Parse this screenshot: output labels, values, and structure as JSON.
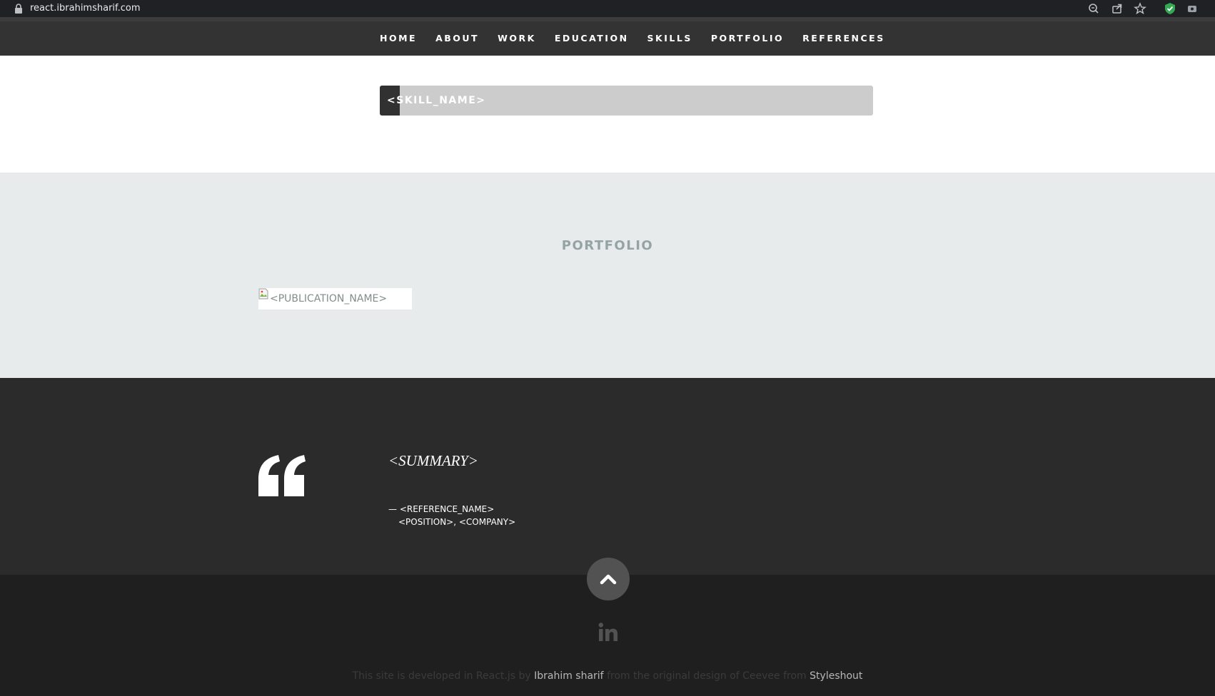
{
  "browser": {
    "url": "react.ibrahimsharif.com",
    "icons": [
      "lock-icon",
      "zoom-icon",
      "share-icon",
      "bookmark-star-icon",
      "shield-extension-icon",
      "extension-icon"
    ]
  },
  "nav": {
    "items": [
      "HOME",
      "ABOUT",
      "WORK",
      "EDUCATION",
      "SKILLS",
      "PORTFOLIO",
      "REFERENCES"
    ]
  },
  "skills": {
    "items": [
      {
        "name": "<SKILL_NAME>",
        "level_percent": 4
      }
    ],
    "colors": {
      "bar_bg": "#cccccc",
      "bar_fill": "#313131"
    }
  },
  "portfolio": {
    "title": "PORTFOLIO",
    "items": [
      {
        "alt": "<PUBLICATION_NAME>"
      }
    ]
  },
  "references": {
    "summary": "<SUMMARY>",
    "name_line": "— <REFERENCE_NAME>",
    "position_line": "<POSITION>, <COMPANY>"
  },
  "footer": {
    "social": [
      "linkedin-icon"
    ],
    "credit_prefix": "This site is developed in React.js by ",
    "author_link": "Ibrahim sharif",
    "credit_middle": " from the original design of Ceevee from ",
    "design_link": "Styleshout"
  }
}
